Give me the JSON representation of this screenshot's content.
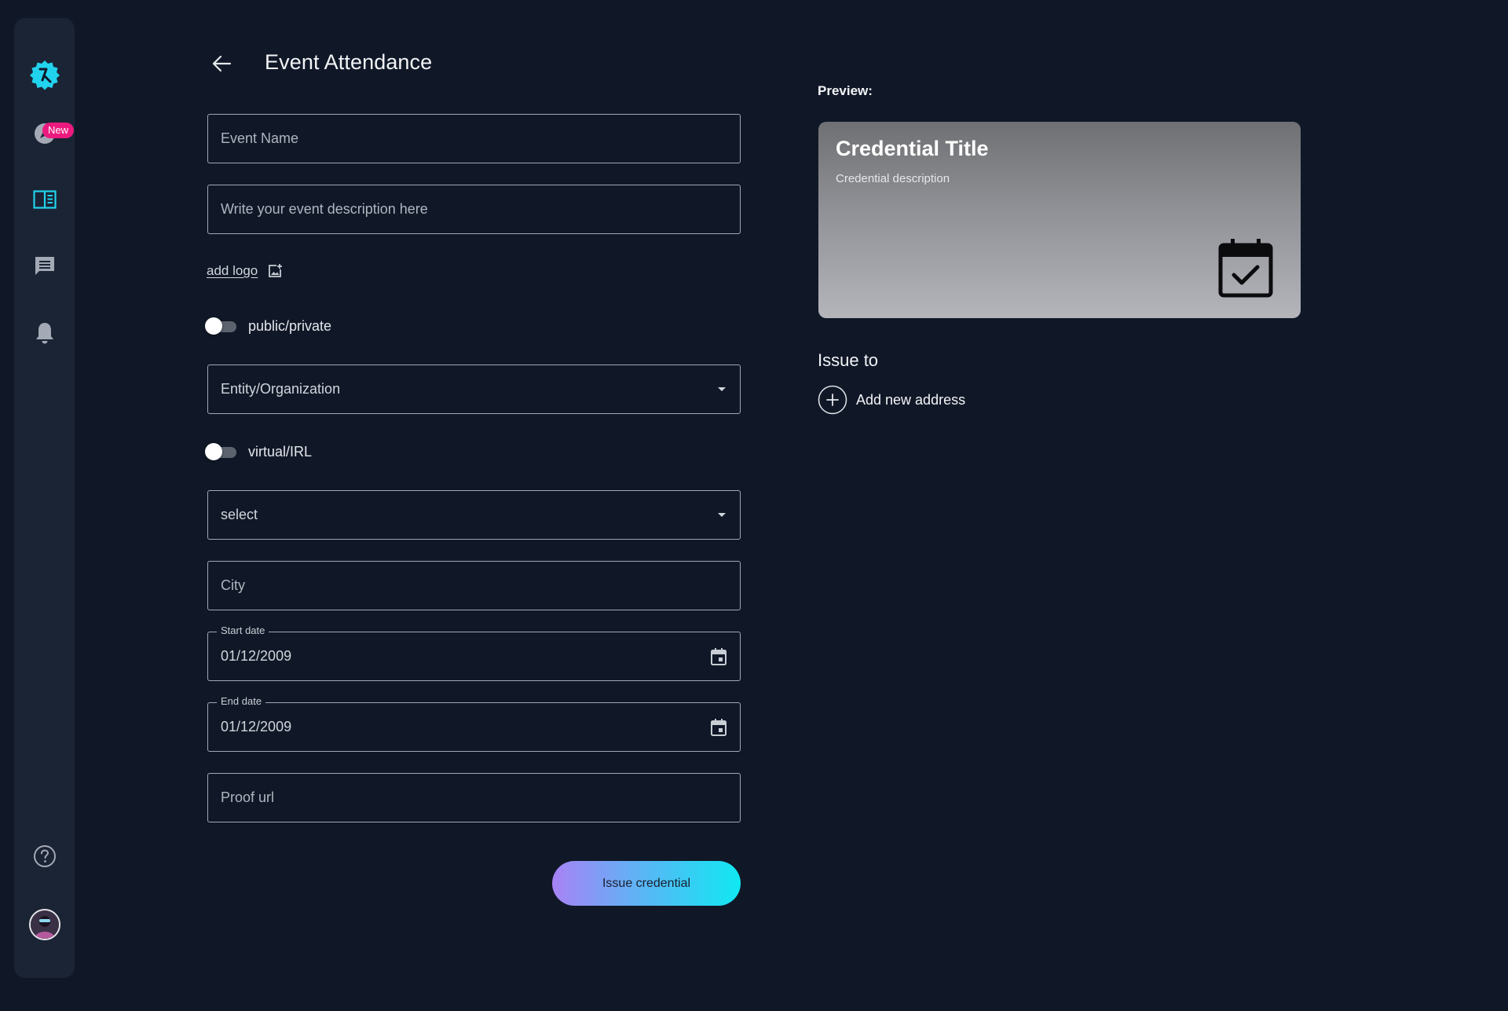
{
  "sidebar": {
    "items": [
      {
        "name": "logo",
        "icon": "logo-badge-icon"
      },
      {
        "name": "explore",
        "icon": "compass-icon",
        "badge": "New"
      },
      {
        "name": "credentials",
        "icon": "book-icon"
      },
      {
        "name": "messages",
        "icon": "chat-icon"
      },
      {
        "name": "notifications",
        "icon": "bell-icon"
      },
      {
        "name": "help",
        "icon": "help-circle-icon"
      },
      {
        "name": "profile",
        "icon": "avatar"
      }
    ],
    "accent_color": "#22d3ee",
    "badge_color": "#ec1a7e"
  },
  "header": {
    "title": "Event Attendance"
  },
  "form": {
    "event_name_placeholder": "Event Name",
    "description_placeholder": "Write your event description here",
    "add_logo_label": "add logo",
    "public_private_label": "public/private",
    "entity_select_value": "Entity/Organization",
    "virtual_irl_label": "virtual/IRL",
    "type_select_value": "select",
    "city_placeholder": "City",
    "start_date_label": "Start date",
    "start_date_value": "01/12/2009",
    "end_date_label": "End date",
    "end_date_value": "01/12/2009",
    "proof_url_placeholder": "Proof url",
    "submit_label": "Issue credential"
  },
  "preview": {
    "label": "Preview:",
    "card_title": "Credential Title",
    "card_description": "Credential description",
    "card_icon": "calendar-check-icon",
    "issue_to_label": "Issue to",
    "add_address_label": "Add new address"
  }
}
